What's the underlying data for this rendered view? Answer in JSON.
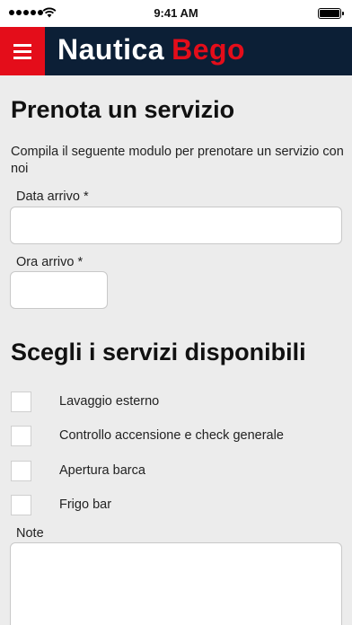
{
  "status_bar": {
    "time": "9:41 AM"
  },
  "header": {
    "brand_part1": "Nautica",
    "brand_part2": "Bego",
    "colors": {
      "bar": "#0c1f36",
      "accent": "#e40d1a"
    }
  },
  "form": {
    "title": "Prenota un servizio",
    "intro": "Compila il seguente modulo per prenotare un servizio con noi",
    "arrival_date_label": "Data arrivo *",
    "arrival_date_value": "",
    "arrival_time_label": "Ora arrivo *",
    "arrival_time_value": "",
    "services_title": "Scegli i servizi disponibili",
    "services": [
      {
        "label": "Lavaggio esterno",
        "checked": false
      },
      {
        "label": "Controllo accensione e check generale",
        "checked": false
      },
      {
        "label": "Apertura barca",
        "checked": false
      },
      {
        "label": "Frigo bar",
        "checked": false
      }
    ],
    "notes_label": "Note",
    "notes_value": ""
  }
}
